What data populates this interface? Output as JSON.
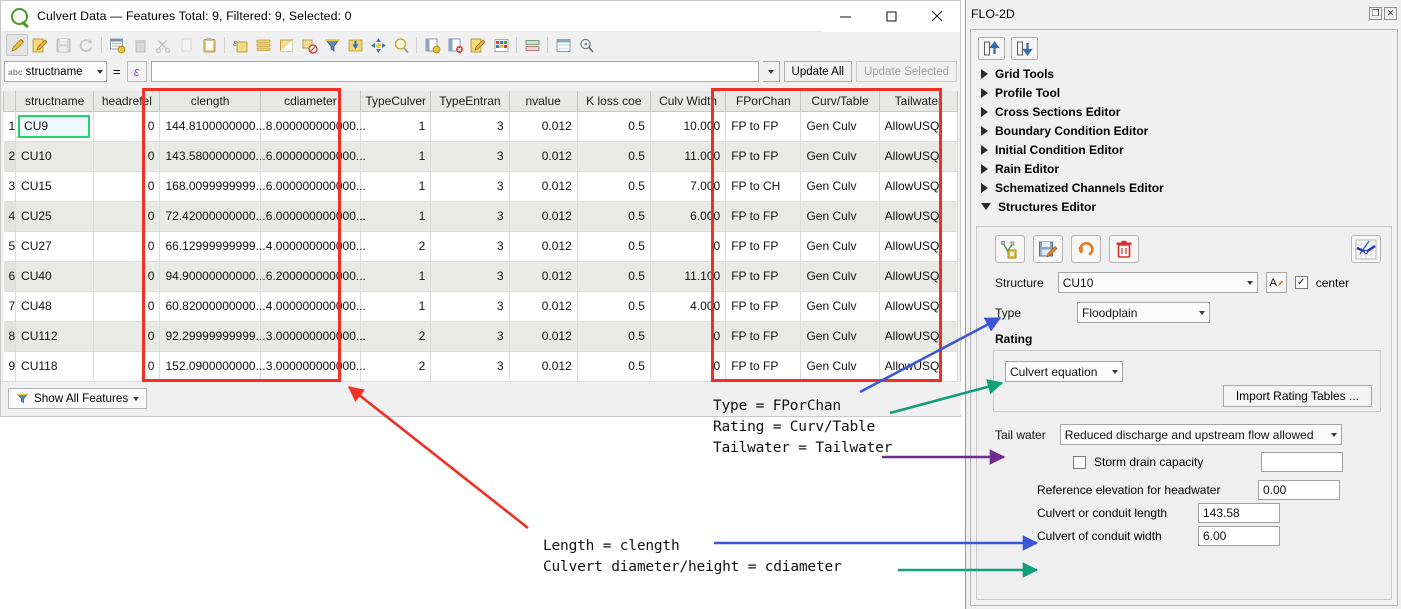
{
  "window": {
    "title": "Culvert Data — Features Total: 9, Filtered: 9, Selected: 0",
    "logo_icon": "qgis-logo-icon",
    "minimize_label": "—",
    "maximize_label": "□",
    "close_label": "✕"
  },
  "toolbar": {
    "buttons": [
      {
        "name": "toggle-editing-icon",
        "glyph": "pencil"
      },
      {
        "name": "save-edits-icon",
        "glyph": "edit-save"
      },
      {
        "name": "save-layer-edits-icon",
        "glyph": "floppy"
      },
      {
        "name": "reload-table-icon",
        "glyph": "refresh"
      },
      {
        "name": "add-feature-icon",
        "glyph": "add-record"
      },
      {
        "name": "delete-selected-icon",
        "glyph": "trash"
      },
      {
        "name": "cut-features-icon",
        "glyph": "scissors"
      },
      {
        "name": "copy-features-icon",
        "glyph": "copy"
      },
      {
        "name": "paste-features-icon",
        "glyph": "clipboard"
      },
      {
        "name": "select-by-expression-icon",
        "glyph": "epsilon-select"
      },
      {
        "name": "select-all-icon",
        "glyph": "rows"
      },
      {
        "name": "invert-selection-icon",
        "glyph": "invert"
      },
      {
        "name": "deselect-all-icon",
        "glyph": "deselect"
      },
      {
        "name": "filter-icon",
        "glyph": "funnel"
      },
      {
        "name": "move-selection-to-top-icon",
        "glyph": "move-top"
      },
      {
        "name": "pan-map-to-feature-icon",
        "glyph": "pan"
      },
      {
        "name": "zoom-map-to-feature-icon",
        "glyph": "zoom"
      },
      {
        "name": "new-field-icon",
        "glyph": "new-field"
      },
      {
        "name": "delete-field-icon",
        "glyph": "delete-field"
      },
      {
        "name": "open-field-calculator-icon",
        "glyph": "field-calc"
      },
      {
        "name": "conditional-formatting-icon",
        "glyph": "cond-format"
      },
      {
        "name": "organize-columns-icon",
        "glyph": "organize"
      },
      {
        "name": "actions-icon",
        "glyph": "actions"
      },
      {
        "name": "form-view-icon",
        "glyph": "form-view"
      }
    ]
  },
  "filterbar": {
    "field_prefix": "abc",
    "field": "structname",
    "operator": "=",
    "expression_button": "ε",
    "expression_value": "",
    "update_all_label": "Update All",
    "update_selected_label": "Update Selected"
  },
  "table": {
    "columns": [
      "structname",
      "headrefel",
      "clength",
      "cdiameter",
      "TypeCulver",
      "TypeEntran",
      "nvalue",
      "K loss coe",
      "Culv Width",
      "FPorChan",
      "Curv/Table",
      "Tailwater"
    ],
    "rows": [
      {
        "idx": "1",
        "structname": "CU9",
        "headrefel": "0",
        "clength": "144.8100000000...",
        "cdiameter": "8.000000000000...",
        "TypeCulver": "1",
        "TypeEntran": "3",
        "nvalue": "0.012",
        "K loss coe": "0.5",
        "Culv Width": "10.000",
        "FPorChan": "FP to FP",
        "Curv/Table": "Gen Culv",
        "Tailwater": "AllowUSQ"
      },
      {
        "idx": "2",
        "structname": "CU10",
        "headrefel": "0",
        "clength": "143.5800000000...",
        "cdiameter": "6.000000000000...",
        "TypeCulver": "1",
        "TypeEntran": "3",
        "nvalue": "0.012",
        "K loss coe": "0.5",
        "Culv Width": "11.000",
        "FPorChan": "FP to FP",
        "Curv/Table": "Gen Culv",
        "Tailwater": "AllowUSQ"
      },
      {
        "idx": "3",
        "structname": "CU15",
        "headrefel": "0",
        "clength": "168.0099999999...",
        "cdiameter": "6.000000000000...",
        "TypeCulver": "1",
        "TypeEntran": "3",
        "nvalue": "0.012",
        "K loss coe": "0.5",
        "Culv Width": "7.000",
        "FPorChan": "FP to CH",
        "Curv/Table": "Gen Culv",
        "Tailwater": "AllowUSQ"
      },
      {
        "idx": "4",
        "structname": "CU25",
        "headrefel": "0",
        "clength": "72.42000000000...",
        "cdiameter": "6.000000000000...",
        "TypeCulver": "1",
        "TypeEntran": "3",
        "nvalue": "0.012",
        "K loss coe": "0.5",
        "Culv Width": "6.000",
        "FPorChan": "FP to FP",
        "Curv/Table": "Gen Culv",
        "Tailwater": "AllowUSQ"
      },
      {
        "idx": "5",
        "structname": "CU27",
        "headrefel": "0",
        "clength": "66.12999999999...",
        "cdiameter": "4.000000000000...",
        "TypeCulver": "2",
        "TypeEntran": "3",
        "nvalue": "0.012",
        "K loss coe": "0.5",
        "Culv Width": "0",
        "FPorChan": "FP to FP",
        "Curv/Table": "Gen Culv",
        "Tailwater": "AllowUSQ"
      },
      {
        "idx": "6",
        "structname": "CU40",
        "headrefel": "0",
        "clength": "94.90000000000...",
        "cdiameter": "6.200000000000...",
        "TypeCulver": "1",
        "TypeEntran": "3",
        "nvalue": "0.012",
        "K loss coe": "0.5",
        "Culv Width": "11.100",
        "FPorChan": "FP to FP",
        "Curv/Table": "Gen Culv",
        "Tailwater": "AllowUSQ"
      },
      {
        "idx": "7",
        "structname": "CU48",
        "headrefel": "0",
        "clength": "60.82000000000...",
        "cdiameter": "4.000000000000...",
        "TypeCulver": "1",
        "TypeEntran": "3",
        "nvalue": "0.012",
        "K loss coe": "0.5",
        "Culv Width": "4.000",
        "FPorChan": "FP to FP",
        "Curv/Table": "Gen Culv",
        "Tailwater": "AllowUSQ"
      },
      {
        "idx": "8",
        "structname": "CU112",
        "headrefel": "0",
        "clength": "92.29999999999...",
        "cdiameter": "3.000000000000...",
        "TypeCulver": "2",
        "TypeEntran": "3",
        "nvalue": "0.012",
        "K loss coe": "0.5",
        "Culv Width": "0",
        "FPorChan": "FP to FP",
        "Curv/Table": "Gen Culv",
        "Tailwater": "AllowUSQ"
      },
      {
        "idx": "9",
        "structname": "CU118",
        "headrefel": "0",
        "clength": "152.0900000000...",
        "cdiameter": "3.000000000000...",
        "TypeCulver": "2",
        "TypeEntran": "3",
        "nvalue": "0.012",
        "K loss coe": "0.5",
        "Culv Width": "0",
        "FPorChan": "FP to FP",
        "Curv/Table": "Gen Culv",
        "Tailwater": "AllowUSQ"
      }
    ],
    "selected_cell": "CU9"
  },
  "statusbar": {
    "show_all_features_label": "Show All Features",
    "filter_icon": "funnel-icon"
  },
  "flo2d": {
    "panel_title": "FLO-2D",
    "float_button": "❐",
    "close_button": "✕",
    "tools": [
      {
        "name": "collapse-all-icon",
        "glyph": "arrow-up"
      },
      {
        "name": "expand-all-icon",
        "glyph": "arrow-down"
      }
    ],
    "tree": [
      {
        "label": "Grid Tools",
        "expanded": false
      },
      {
        "label": "Profile Tool",
        "expanded": false
      },
      {
        "label": "Cross Sections Editor",
        "expanded": false
      },
      {
        "label": "Boundary Condition Editor",
        "expanded": false
      },
      {
        "label": "Initial Condition Editor",
        "expanded": false
      },
      {
        "label": "Rain Editor",
        "expanded": false
      },
      {
        "label": "Schematized Channels Editor",
        "expanded": false
      },
      {
        "label": "Structures Editor",
        "expanded": true
      }
    ],
    "structures_editor": {
      "toolbar": [
        {
          "name": "add-structure-icon",
          "glyph": "add-struct"
        },
        {
          "name": "save-structure-icon",
          "glyph": "save-struct"
        },
        {
          "name": "revert-changes-icon",
          "glyph": "undo"
        },
        {
          "name": "delete-structure-icon",
          "glyph": "trash-red"
        },
        {
          "name": "schematize-structure-icon",
          "glyph": "schematize"
        }
      ],
      "structure_label": "Structure",
      "structure_value": "CU10",
      "rename_button": "A",
      "center_checkbox_label": "center",
      "center_checked": true,
      "type_label": "Type",
      "type_value": "Floodplain",
      "rating_group_label": "Rating",
      "rating_value": "Culvert equation",
      "import_rating_tables_label": "Import Rating Tables ...",
      "tail_water_label": "Tail water",
      "tail_water_value": "Reduced discharge and upstream flow allowed",
      "storm_drain_label": "Storm drain capacity",
      "storm_drain_checked": false,
      "storm_drain_value": "",
      "ref_elev_label": "Reference elevation for headwater",
      "ref_elev_value": "0.00",
      "culvert_length_label": "Culvert or conduit length",
      "culvert_length_value": "143.58",
      "culvert_width_label": "Culvert of conduit width",
      "culvert_width_value": "6.00"
    }
  },
  "annotations": {
    "upper_block_line1": "Type = FPorChan",
    "upper_block_line2": "Rating = Curv/Table",
    "upper_block_line3": "Tailwater = Tailwater",
    "lower_block_line1": "Length = clength",
    "lower_block_line2": "Culvert diameter/height = cdiameter"
  },
  "colors": {
    "highlight_red": "#ee3124",
    "arrow_blue": "#3b57d8",
    "arrow_green": "#13a078",
    "arrow_purple": "#6b2d8f",
    "selection_green": "#24d46a"
  }
}
